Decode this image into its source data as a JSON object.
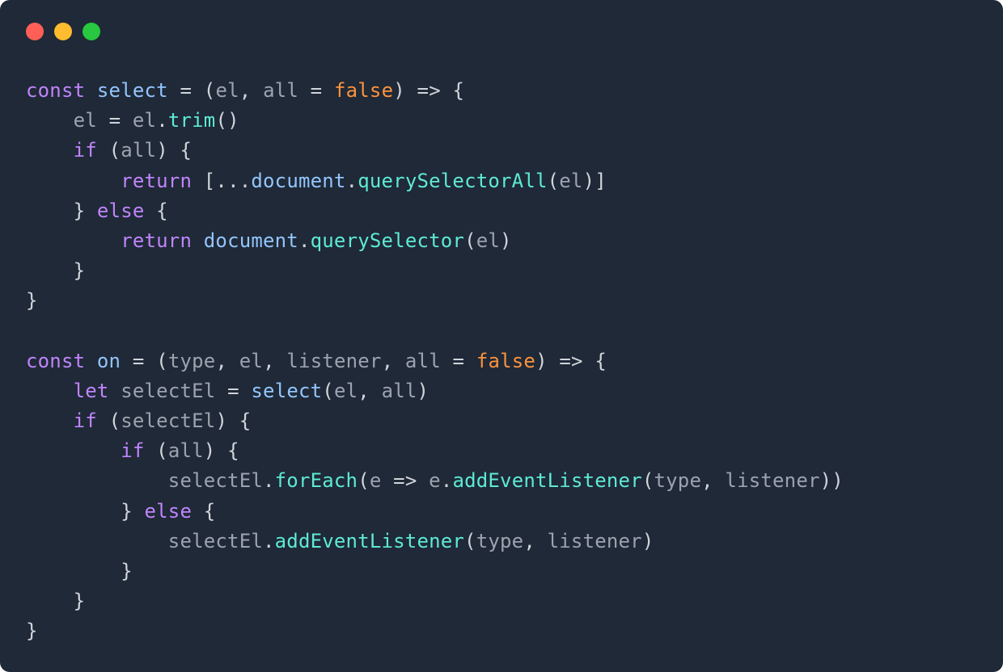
{
  "colors": {
    "bg": "#1f2937",
    "text": "#d1d5db",
    "keyword": "#c084fc",
    "identifier": "#93c5fd",
    "property": "#5eead4",
    "literal": "#fb923c",
    "traffic_red": "#ff5f57",
    "traffic_yellow": "#febc2e",
    "traffic_green": "#28c840"
  },
  "titlebar": {
    "buttons": [
      "close",
      "minimize",
      "zoom"
    ]
  },
  "code": {
    "language": "javascript",
    "tokens": [
      [
        [
          "kw",
          "const"
        ],
        [
          "pn",
          " "
        ],
        [
          "id",
          "select"
        ],
        [
          "pn",
          " "
        ],
        [
          "pn",
          "="
        ],
        [
          "pn",
          " "
        ],
        [
          "pn",
          "("
        ],
        [
          "dim",
          "el"
        ],
        [
          "pn",
          ", "
        ],
        [
          "dim",
          "all"
        ],
        [
          "pn",
          " "
        ],
        [
          "pn",
          "="
        ],
        [
          "pn",
          " "
        ],
        [
          "lit",
          "false"
        ],
        [
          "pn",
          ")"
        ],
        [
          "pn",
          " "
        ],
        [
          "pn",
          "=>"
        ],
        [
          "pn",
          " "
        ],
        [
          "pn",
          "{"
        ]
      ],
      [
        [
          "pn",
          "    "
        ],
        [
          "dim",
          "el"
        ],
        [
          "pn",
          " "
        ],
        [
          "pn",
          "="
        ],
        [
          "pn",
          " "
        ],
        [
          "dim",
          "el"
        ],
        [
          "pn",
          "."
        ],
        [
          "teal",
          "trim"
        ],
        [
          "pn",
          "()"
        ]
      ],
      [
        [
          "pn",
          "    "
        ],
        [
          "kw",
          "if"
        ],
        [
          "pn",
          " ("
        ],
        [
          "dim",
          "all"
        ],
        [
          "pn",
          ") "
        ],
        [
          "pn",
          "{"
        ]
      ],
      [
        [
          "pn",
          "        "
        ],
        [
          "kw",
          "return"
        ],
        [
          "pn",
          " ["
        ],
        [
          "pn",
          "..."
        ],
        [
          "id",
          "document"
        ],
        [
          "pn",
          "."
        ],
        [
          "teal",
          "querySelectorAll"
        ],
        [
          "pn",
          "("
        ],
        [
          "dim",
          "el"
        ],
        [
          "pn",
          ")]"
        ]
      ],
      [
        [
          "pn",
          "    } "
        ],
        [
          "kw",
          "else"
        ],
        [
          "pn",
          " {"
        ]
      ],
      [
        [
          "pn",
          "        "
        ],
        [
          "kw",
          "return"
        ],
        [
          "pn",
          " "
        ],
        [
          "id",
          "document"
        ],
        [
          "pn",
          "."
        ],
        [
          "teal",
          "querySelector"
        ],
        [
          "pn",
          "("
        ],
        [
          "dim",
          "el"
        ],
        [
          "pn",
          ")"
        ]
      ],
      [
        [
          "pn",
          "    }"
        ]
      ],
      [
        [
          "pn",
          "}"
        ]
      ],
      [
        [
          "pn",
          ""
        ]
      ],
      [
        [
          "kw",
          "const"
        ],
        [
          "pn",
          " "
        ],
        [
          "id",
          "on"
        ],
        [
          "pn",
          " "
        ],
        [
          "pn",
          "="
        ],
        [
          "pn",
          " ("
        ],
        [
          "dim",
          "type"
        ],
        [
          "pn",
          ", "
        ],
        [
          "dim",
          "el"
        ],
        [
          "pn",
          ", "
        ],
        [
          "dim",
          "listener"
        ],
        [
          "pn",
          ", "
        ],
        [
          "dim",
          "all"
        ],
        [
          "pn",
          " "
        ],
        [
          "pn",
          "="
        ],
        [
          "pn",
          " "
        ],
        [
          "lit",
          "false"
        ],
        [
          "pn",
          ") "
        ],
        [
          "pn",
          "=>"
        ],
        [
          "pn",
          " {"
        ]
      ],
      [
        [
          "pn",
          "    "
        ],
        [
          "kw",
          "let"
        ],
        [
          "pn",
          " "
        ],
        [
          "dim",
          "selectEl"
        ],
        [
          "pn",
          " "
        ],
        [
          "pn",
          "="
        ],
        [
          "pn",
          " "
        ],
        [
          "id",
          "select"
        ],
        [
          "pn",
          "("
        ],
        [
          "dim",
          "el"
        ],
        [
          "pn",
          ", "
        ],
        [
          "dim",
          "all"
        ],
        [
          "pn",
          ")"
        ]
      ],
      [
        [
          "pn",
          "    "
        ],
        [
          "kw",
          "if"
        ],
        [
          "pn",
          " ("
        ],
        [
          "dim",
          "selectEl"
        ],
        [
          "pn",
          ") {"
        ]
      ],
      [
        [
          "pn",
          "        "
        ],
        [
          "kw",
          "if"
        ],
        [
          "pn",
          " ("
        ],
        [
          "dim",
          "all"
        ],
        [
          "pn",
          ") {"
        ]
      ],
      [
        [
          "pn",
          "            "
        ],
        [
          "dim",
          "selectEl"
        ],
        [
          "pn",
          "."
        ],
        [
          "teal",
          "forEach"
        ],
        [
          "pn",
          "("
        ],
        [
          "dim",
          "e"
        ],
        [
          "pn",
          " "
        ],
        [
          "pn",
          "=>"
        ],
        [
          "pn",
          " "
        ],
        [
          "dim",
          "e"
        ],
        [
          "pn",
          "."
        ],
        [
          "teal",
          "addEventListener"
        ],
        [
          "pn",
          "("
        ],
        [
          "dim",
          "type"
        ],
        [
          "pn",
          ", "
        ],
        [
          "dim",
          "listener"
        ],
        [
          "pn",
          "))"
        ]
      ],
      [
        [
          "pn",
          "        } "
        ],
        [
          "kw",
          "else"
        ],
        [
          "pn",
          " {"
        ]
      ],
      [
        [
          "pn",
          "            "
        ],
        [
          "dim",
          "selectEl"
        ],
        [
          "pn",
          "."
        ],
        [
          "teal",
          "addEventListener"
        ],
        [
          "pn",
          "("
        ],
        [
          "dim",
          "type"
        ],
        [
          "pn",
          ", "
        ],
        [
          "dim",
          "listener"
        ],
        [
          "pn",
          ")"
        ]
      ],
      [
        [
          "pn",
          "        }"
        ]
      ],
      [
        [
          "pn",
          "    }"
        ]
      ],
      [
        [
          "pn",
          "}"
        ]
      ]
    ]
  }
}
